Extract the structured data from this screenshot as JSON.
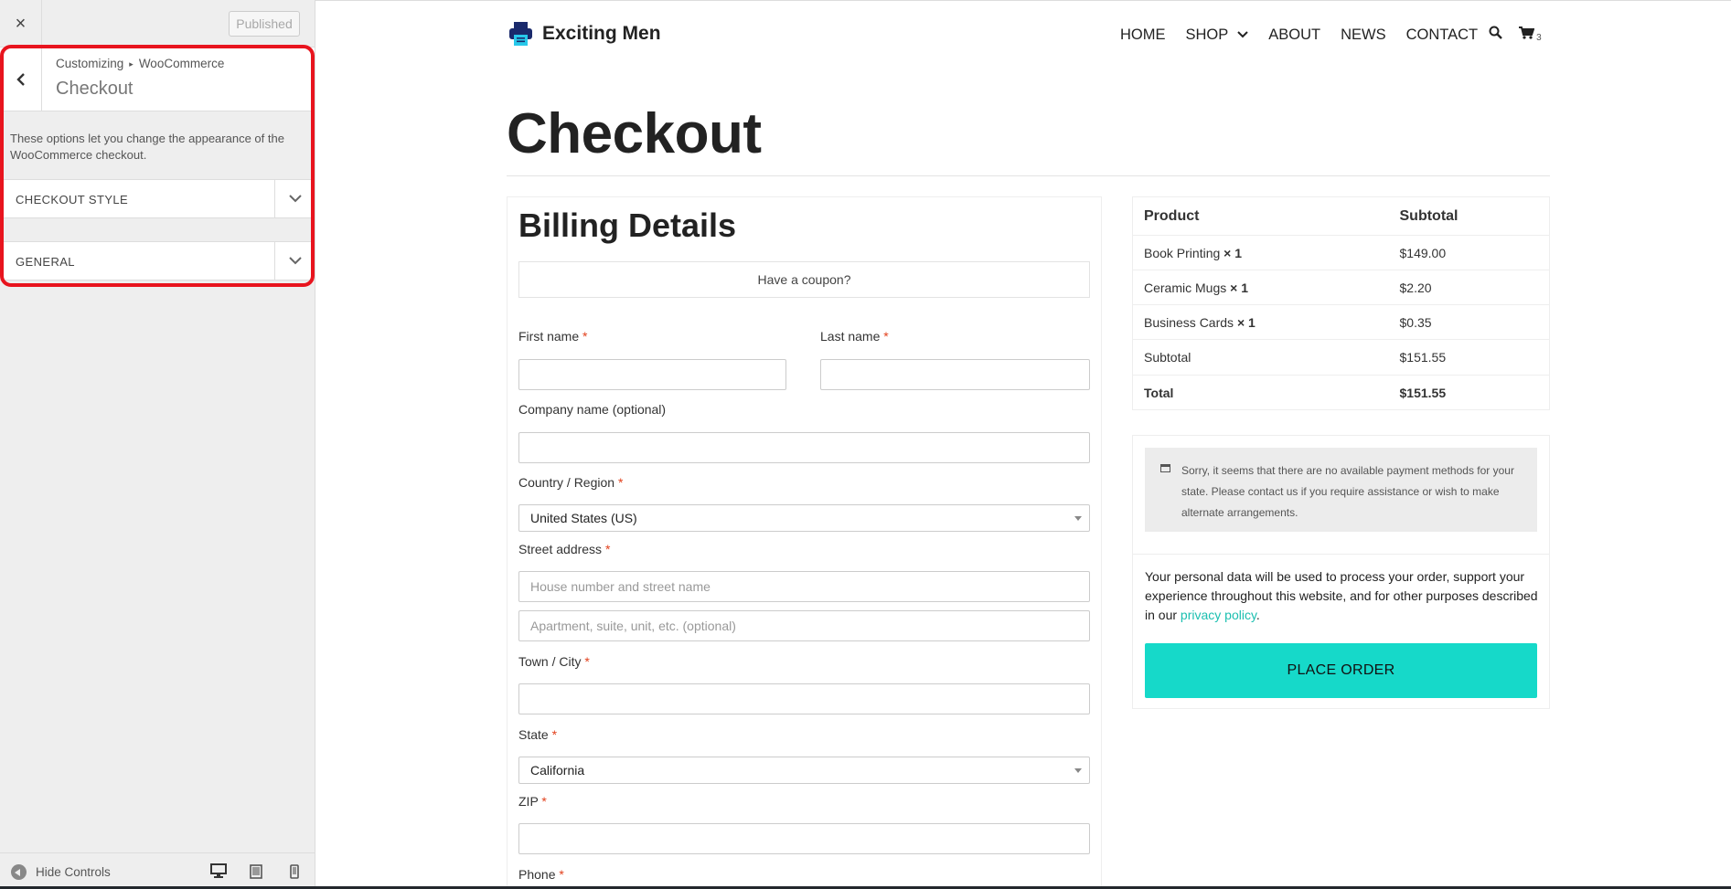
{
  "sidebar": {
    "close_icon": "×",
    "published_label": "Published",
    "breadcrumb": {
      "root": "Customizing",
      "separator": "▸",
      "parent": "WooCommerce"
    },
    "section_title": "Checkout",
    "description": "These options let you change the appearance of the WooCommerce checkout.",
    "sections": [
      {
        "label": "CHECKOUT STYLE"
      },
      {
        "label": "GENERAL"
      }
    ],
    "footer": {
      "hide_controls_label": "Hide Controls"
    },
    "highlight_color": "#e8141e"
  },
  "site": {
    "name": "Exciting Men",
    "nav": [
      "HOME",
      "SHOP",
      "ABOUT",
      "NEWS",
      "CONTACT"
    ],
    "cart_count": "3"
  },
  "checkout": {
    "page_title": "Checkout",
    "billing_title": "Billing Details",
    "coupon_text": "Have a coupon?",
    "required_mark": "*",
    "fields": {
      "first_name": "First name",
      "last_name": "Last name",
      "company": "Company name (optional)",
      "country": "Country / Region",
      "country_value": "United States (US)",
      "street": "Street address",
      "street_placeholder_1": "House number and street name",
      "street_placeholder_2": "Apartment, suite, unit, etc. (optional)",
      "city": "Town / City",
      "state": "State",
      "state_value": "California",
      "zip": "ZIP",
      "phone": "Phone"
    }
  },
  "order": {
    "headers": {
      "product": "Product",
      "subtotal": "Subtotal"
    },
    "items": [
      {
        "name": "Book Printing",
        "qty": "× 1",
        "price": "$149.00"
      },
      {
        "name": "Ceramic Mugs",
        "qty": "× 1",
        "price": "$2.20"
      },
      {
        "name": "Business Cards",
        "qty": "× 1",
        "price": "$0.35"
      }
    ],
    "subtotal_label": "Subtotal",
    "subtotal_value": "$151.55",
    "total_label": "Total",
    "total_value": "$151.55"
  },
  "payment": {
    "notice": "Sorry, it seems that there are no available payment methods for your state. Please contact us if you require assistance or wish to make alternate arrangements.",
    "privacy_text": "Your personal data will be used to process your order, support your experience throughout this website, and for other purposes described in our",
    "privacy_link": "privacy policy",
    "privacy_end": ".",
    "place_order": "PLACE ORDER",
    "accent_color": "#16d9c9"
  }
}
